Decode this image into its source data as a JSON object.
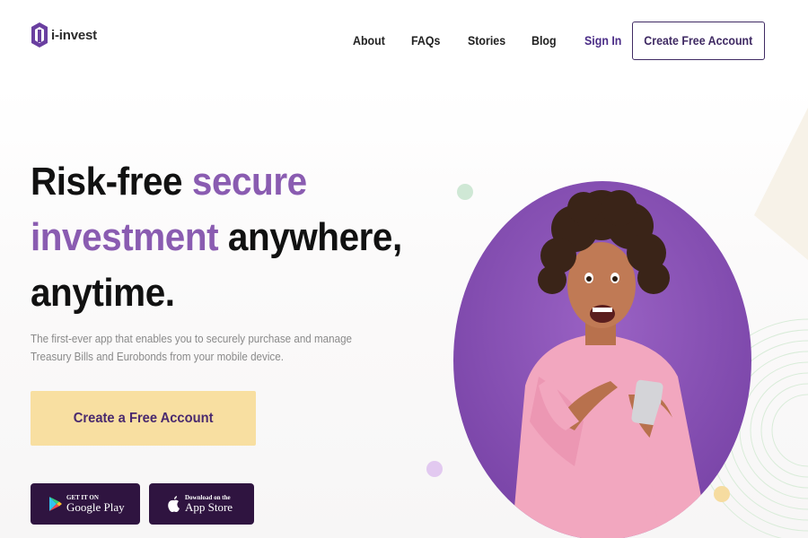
{
  "brand": {
    "name": "i-invest",
    "primary_color": "#8a5cb1",
    "dark_color": "#2f1440",
    "cta_color": "#f8dfa1"
  },
  "nav": {
    "links": [
      "About",
      "FAQs",
      "Stories",
      "Blog"
    ],
    "signin_label": "Sign In",
    "create_account_label": "Create Free Account"
  },
  "hero": {
    "headline_parts": [
      "Risk-free",
      "secure",
      "investment",
      "anywhere,",
      "anytime."
    ],
    "subtext_lines": [
      "The first-ever app that enables you to securely purchase and manage",
      "Treasury Bills and Eurobonds from your mobile device."
    ],
    "cta_label": "Create a Free Account"
  },
  "stores": {
    "google": {
      "small": "GET IT ON",
      "big": "Google Play",
      "icon": "google-play-icon"
    },
    "apple": {
      "small": "Download on the",
      "big": "App Store",
      "icon": "apple-icon"
    }
  },
  "hero_image": {
    "description_icon": "smiling-woman-pointing-phone"
  }
}
